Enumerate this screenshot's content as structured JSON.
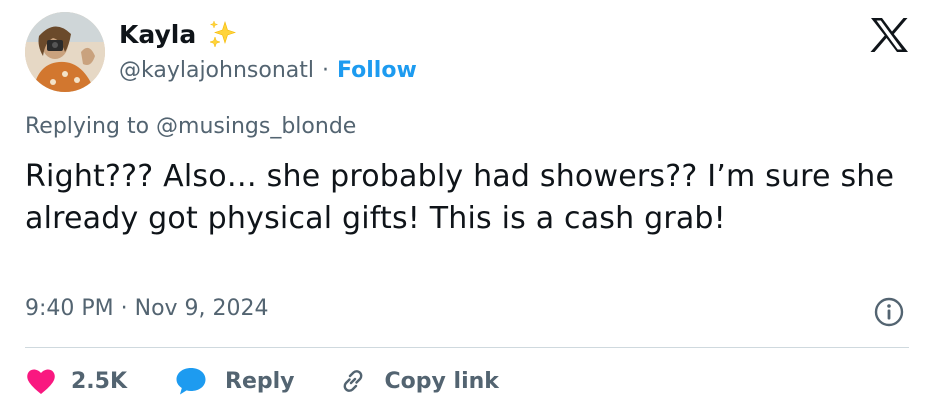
{
  "author": {
    "display_name": "Kayla",
    "handle": "@kaylajohnsonatl",
    "separator": "·",
    "follow_label": "Follow"
  },
  "icons": {
    "badge": "sparkles-icon",
    "brand": "x-logo-icon",
    "info": "info-icon",
    "like": "heart-icon",
    "reply": "speech-bubble-icon",
    "copy": "link-icon"
  },
  "colors": {
    "link": "#1d9bf0",
    "like": "#f91880",
    "secondary_text": "#536471",
    "sparkle": "#ffd43b"
  },
  "tweet": {
    "replying_to": "Replying to @musings_blonde",
    "text": "Right??? Also… she probably had showers?? I’m sure she already got physical gifts! This is a cash grab!",
    "timestamp": "9:40 PM · Nov 9, 2024"
  },
  "actions": {
    "like_count": "2.5K",
    "reply_label": "Reply",
    "copy_label": "Copy link"
  }
}
